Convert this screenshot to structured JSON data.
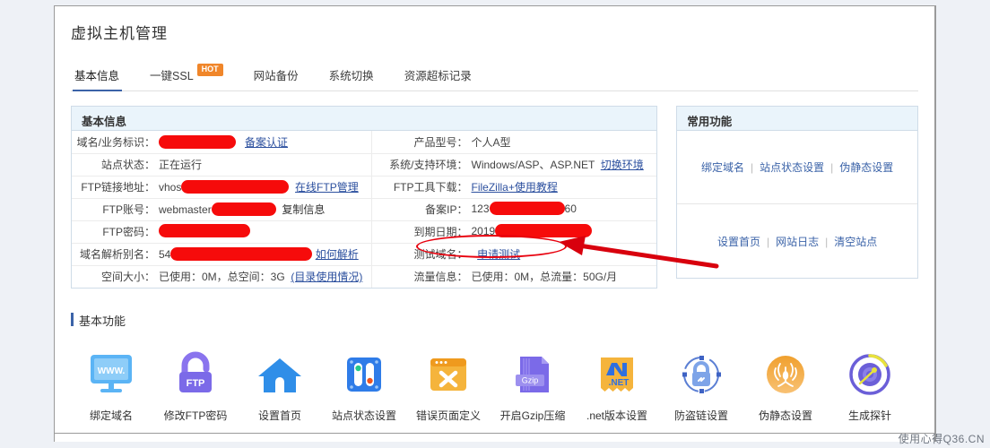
{
  "page": {
    "title": "虚拟主机管理",
    "watermark": "使用心得Q36.CN"
  },
  "tabs": [
    {
      "label": "基本信息",
      "active": true,
      "badge": ""
    },
    {
      "label": "一键SSL",
      "active": false,
      "badge": "HOT"
    },
    {
      "label": "网站备份",
      "active": false,
      "badge": ""
    },
    {
      "label": "系统切换",
      "active": false,
      "badge": ""
    },
    {
      "label": "资源超标记录",
      "active": false,
      "badge": ""
    }
  ],
  "info_panel": {
    "heading": "基本信息",
    "rows": [
      {
        "left_label": "域名/业务标识：",
        "left_value": "",
        "left_redact": 86,
        "left_link": "备案认证",
        "right_label": "产品型号：",
        "right_value": "个人A型",
        "right_redact": 0,
        "right_link": ""
      },
      {
        "left_label": "站点状态：",
        "left_value": "正在运行",
        "left_redact": 0,
        "left_link": "",
        "right_label": "系统/支持环境：",
        "right_value": "Windows/ASP、ASP.NET",
        "right_redact": 0,
        "right_link": "切换环境"
      },
      {
        "left_label": "FTP链接地址：",
        "left_value": "vhos",
        "left_redact": 120,
        "left_link": "在线FTP管理",
        "right_label": "FTP工具下载：",
        "right_value": "",
        "right_redact": 0,
        "right_link": "FileZilla+使用教程"
      },
      {
        "left_label": "FTP账号：",
        "left_value": "webmaster",
        "left_redact": 72,
        "left_link": "复制信息",
        "right_label": "备案IP：",
        "right_value": "123",
        "right_redact": 84,
        "right_value_tail": "60",
        "right_link": ""
      },
      {
        "left_label": "FTP密码：",
        "left_value": "",
        "left_redact": 102,
        "left_link": "",
        "right_label": "到期日期：",
        "right_value": "2019",
        "right_redact": 108,
        "right_link": ""
      },
      {
        "left_label": "域名解析别名：",
        "left_value": "54",
        "left_redact": 158,
        "left_link": "如何解析",
        "right_label": "测试域名：",
        "right_value": "",
        "right_redact": 0,
        "right_link": "申请测试"
      },
      {
        "left_label": "空间大小：",
        "left_value": "已使用：0M，总空间：3G",
        "left_redact": 0,
        "left_link": "(目录使用情况)",
        "right_label": "流量信息：",
        "right_value": "已使用：0M，总流量：50G/月",
        "right_redact": 0,
        "right_link": ""
      }
    ]
  },
  "function_panel": {
    "heading": "常用功能",
    "group1": [
      "绑定域名",
      "站点状态设置",
      "伪静态设置"
    ],
    "group2": [
      "设置首页",
      "网站日志",
      "清空站点"
    ],
    "divider": "|"
  },
  "basic_functions": {
    "heading": "基本功能",
    "items": [
      {
        "label": "绑定域名",
        "icon": "monitor-www-icon",
        "color": "#49a8f0"
      },
      {
        "label": "修改FTP密码",
        "icon": "ftp-lock-icon",
        "color": "#7a6ee8"
      },
      {
        "label": "设置首页",
        "icon": "home-icon",
        "color": "#2f8ee8"
      },
      {
        "label": "站点状态设置",
        "icon": "toggle-switch-icon",
        "color": "#2f7ce8"
      },
      {
        "label": "错误页面定义",
        "icon": "browser-error-icon",
        "color": "#f5a623"
      },
      {
        "label": "开启Gzip压缩",
        "icon": "gzip-file-icon",
        "color": "#7a6ee8"
      },
      {
        "label": ".net版本设置",
        "icon": "dotnet-icon",
        "color": "#f5a623"
      },
      {
        "label": "防盗链设置",
        "icon": "chain-lock-icon",
        "color": "#5b7fd4"
      },
      {
        "label": "伪静态设置",
        "icon": "spider-icon",
        "color": "#f4a93c"
      },
      {
        "label": "生成探针",
        "icon": "radar-probe-icon",
        "color": "#6b5fd8"
      }
    ]
  },
  "colors": {
    "accent_blue": "#3b63a8",
    "panel_head_bg": "#eaf4fb",
    "hot_orange": "#f0862a",
    "redact_red": "#f60b0b",
    "annotation_red": "#e8000d",
    "page_bg": "#eef1f6"
  }
}
